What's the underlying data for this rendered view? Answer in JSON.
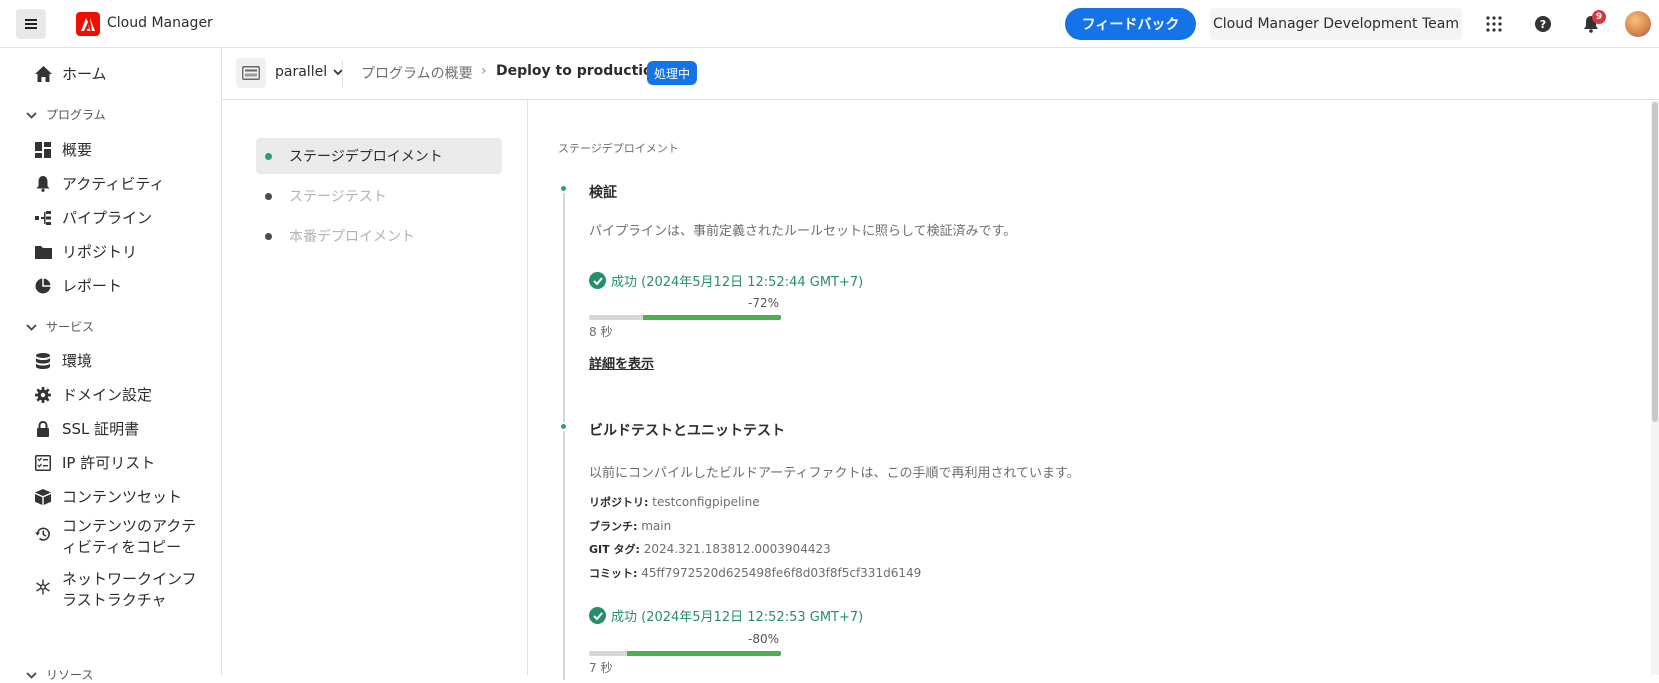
{
  "header": {
    "app_title": "Cloud Manager",
    "feedback_label": "フィードバック",
    "org_name": "Cloud Manager Development Team",
    "notification_count": "9",
    "icons": {
      "menu": "hamburger-icon",
      "logo": "adobe-logo",
      "apps": "grid-icon",
      "help": "help-icon",
      "notifications": "bell-icon"
    }
  },
  "sidebar": {
    "home": "ホーム",
    "program_section": "プログラム",
    "program_items": [
      {
        "label": "概要",
        "icon": "dashboard-icon"
      },
      {
        "label": "アクティビティ",
        "icon": "bell-icon"
      },
      {
        "label": "パイプライン",
        "icon": "pipeline-icon"
      },
      {
        "label": "リポジトリ",
        "icon": "folder-icon"
      },
      {
        "label": "レポート",
        "icon": "pie-icon"
      }
    ],
    "services_section": "サービス",
    "service_items": [
      {
        "label": "環境",
        "icon": "database-icon"
      },
      {
        "label": "ドメイン設定",
        "icon": "gear-icon"
      },
      {
        "label": "SSL 証明書",
        "icon": "lock-icon"
      },
      {
        "label": "IP 許可リスト",
        "icon": "checklist-icon"
      },
      {
        "label": "コンテンツセット",
        "icon": "box-icon"
      },
      {
        "label_line1": "コンテンツのアクテ",
        "label_line2": "ィビティをコピー",
        "icon": "history-icon"
      },
      {
        "label_line1": "ネットワークインフ",
        "label_line2": "ラストラクチャ",
        "icon": "network-icon"
      }
    ],
    "resources_section": "リソース"
  },
  "breadcrumb": {
    "program": "parallel",
    "overview": "プログラムの概要",
    "separator": "›",
    "current": "Deploy to production",
    "status": "処理中"
  },
  "steps": [
    {
      "label": "ステージデプロイメント",
      "state": "active"
    },
    {
      "label": "ステージテスト",
      "state": "inactive"
    },
    {
      "label": "本番デプロイメント",
      "state": "inactive"
    }
  ],
  "detail": {
    "section_label": "ステージデプロイメント",
    "validation": {
      "title": "検証",
      "description": "パイプラインは、事前定義されたルールセットに照らして検証済みです。",
      "status": "成功 (2024年5月12日 12:52:44 GMT+7)",
      "percent_label": "-72%",
      "percent_fill": 0.72,
      "duration": "8 秒",
      "details_link": "詳細を表示"
    },
    "build": {
      "title": "ビルドテストとユニットテスト",
      "description": "以前にコンパイルしたビルドアーティファクトは、この手順で再利用されています。",
      "repo_label": "リポジトリ:",
      "repo_value": "testconfigpipeline",
      "branch_label": "ブランチ:",
      "branch_value": "main",
      "tag_label": "GIT タグ:",
      "tag_value": "2024.321.183812.0003904423",
      "commit_label": "コミット:",
      "commit_value": "45ff7972520d625498fe6f8d03f8f5cf331d6149",
      "status": "成功 (2024年5月12日 12:52:53 GMT+7)",
      "percent_label": "-80%",
      "percent_fill": 0.8,
      "duration": "7 秒"
    }
  },
  "colors": {
    "accent": "#1473e6",
    "success": "#268e6c",
    "progress": "#4caf50",
    "brand": "#eb1000"
  }
}
